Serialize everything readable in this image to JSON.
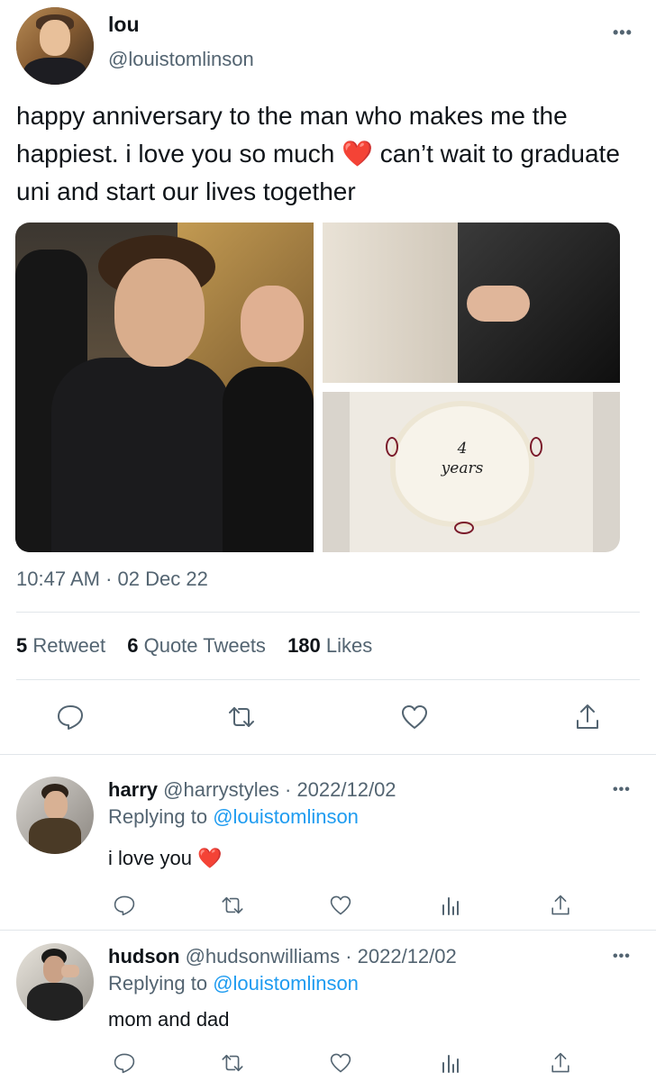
{
  "tweet": {
    "display_name": "lou",
    "handle": "@louistomlinson",
    "more_label": "•••",
    "text_before_emoji": "happy anniversary to the man who makes me the happiest. i love you so much ",
    "emoji": "❤️",
    "text_after_emoji": "  can’t wait to graduate uni and start our lives together",
    "media": {
      "cake_text_line1": "4",
      "cake_text_line2": "years"
    },
    "time": "10:47 AM",
    "date_separator": " · ",
    "date": "02 Dec 22",
    "stats": {
      "retweets_count": "5",
      "retweets_label": "Retweet",
      "quotes_count": "6",
      "quotes_label": "Quote Tweets",
      "likes_count": "180",
      "likes_label": "Likes"
    }
  },
  "replies": [
    {
      "name": "harry",
      "handle": "@harrystyles",
      "separator": " · ",
      "date": "2022/12/02",
      "replying_prefix": "Replying to ",
      "replying_to": "@louistomlinson",
      "text": "i love you ",
      "emoji": "❤️",
      "more_label": "•••"
    },
    {
      "name": "hudson",
      "handle": "@hudsonwilliams",
      "separator": " · ",
      "date": "2022/12/02",
      "replying_prefix": "Replying to ",
      "replying_to": "@louistomlinson",
      "text": "mom and dad",
      "emoji": "",
      "more_label": "•••"
    }
  ],
  "colors": {
    "text_primary": "#0f1419",
    "text_secondary": "#536471",
    "link": "#1d9bf0",
    "divider": "#e1e6ea",
    "heart": "#e0245e"
  },
  "icons": [
    "reply-icon",
    "retweet-icon",
    "like-icon",
    "share-icon",
    "analytics-icon",
    "more-icon"
  ]
}
